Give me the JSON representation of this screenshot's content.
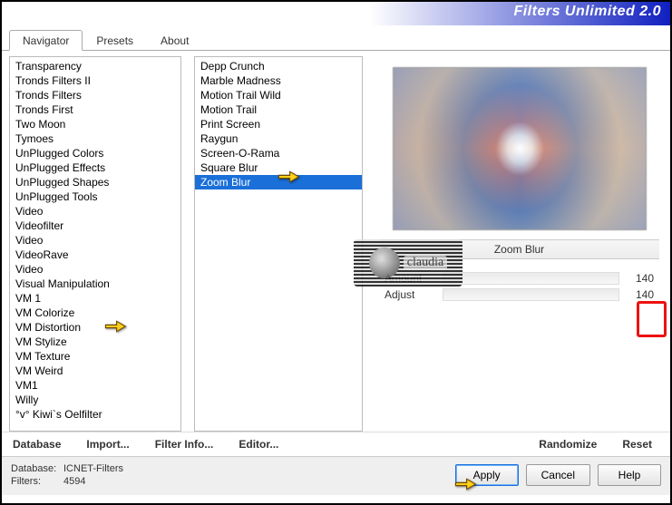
{
  "title": "Filters Unlimited 2.0",
  "tabs": [
    {
      "label": "Navigator",
      "active": true
    },
    {
      "label": "Presets",
      "active": false
    },
    {
      "label": "About",
      "active": false
    }
  ],
  "categories": [
    "Transparency",
    "Tronds Filters II",
    "Tronds Filters",
    "Tronds First",
    "Two Moon",
    "Tymoes",
    "UnPlugged Colors",
    "UnPlugged Effects",
    "UnPlugged Shapes",
    "UnPlugged Tools",
    "Video",
    "Videofilter",
    "Video",
    "VideoRave",
    "Video",
    "Visual Manipulation",
    "VM 1",
    "VM Colorize",
    "VM Distortion",
    "VM Stylize",
    "VM Texture",
    "VM Weird",
    "VM1",
    "Willy",
    "°v° Kiwi`s Oelfilter"
  ],
  "categories_selected_index": 19,
  "filters": [
    "Depp Crunch",
    "Marble Madness",
    "Motion Trail Wild",
    "Motion Trail",
    "Print Screen",
    "Raygun",
    "Screen-O-Rama",
    "Square Blur",
    "Zoom Blur"
  ],
  "filters_selected_index": 8,
  "selected_filter_name": "Zoom Blur",
  "params": [
    {
      "label": "Amount",
      "value": 140
    },
    {
      "label": "Adjust",
      "value": 140
    }
  ],
  "link_buttons": {
    "database": "Database",
    "import": "Import...",
    "filter_info": "Filter Info...",
    "editor": "Editor...",
    "randomize": "Randomize",
    "reset": "Reset"
  },
  "footer": {
    "db_label": "Database:",
    "db_value": "ICNET-Filters",
    "filters_label": "Filters:",
    "filters_value": "4594"
  },
  "buttons": {
    "apply": "Apply",
    "cancel": "Cancel",
    "help": "Help"
  },
  "watermark_text": "claudia"
}
